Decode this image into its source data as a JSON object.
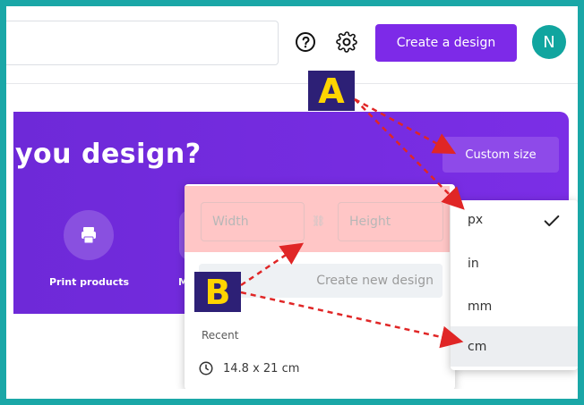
{
  "topbar": {
    "help_icon": "help-circle-icon",
    "settings_icon": "gear-icon",
    "create_button": "Create a design",
    "avatar_initial": "N"
  },
  "hero": {
    "headline": "you design?",
    "custom_size_button": "Custom size",
    "card_label": "Print products",
    "partial_label": "M"
  },
  "popup": {
    "width_placeholder": "Width",
    "height_placeholder": "Height",
    "lock_icon": "link-icon",
    "create_new": "Create new design",
    "recent_label": "Recent",
    "recent_item": "14.8 x 21 cm",
    "clock_icon": "clock-icon"
  },
  "unit_menu": {
    "items": [
      "px",
      "in",
      "mm",
      "cm"
    ],
    "selected": "px",
    "hovered": "cm"
  },
  "annotations": {
    "label_a": "A",
    "label_b": "B"
  },
  "colors": {
    "frame": "#1aa7a7",
    "purple": "#7d2ae8",
    "teal": "#11a59f",
    "arrow": "#e02626",
    "label_bg": "#2d2076",
    "label_fg": "#ffd400"
  }
}
